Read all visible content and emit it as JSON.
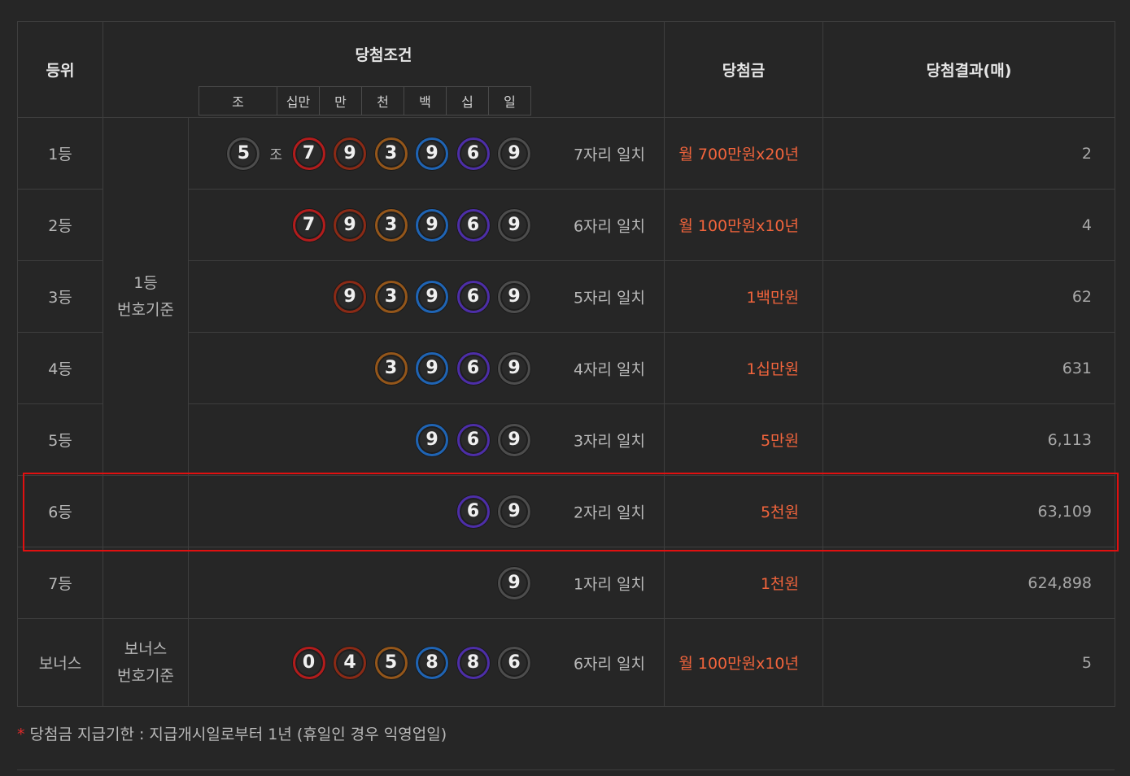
{
  "header": {
    "rank": "등위",
    "condition": "당첨조건",
    "prize": "당첨금",
    "result": "당첨결과(매)",
    "digit_labels": [
      "조",
      "십만",
      "만",
      "천",
      "백",
      "십",
      "일"
    ]
  },
  "basis": {
    "main_line1": "1등",
    "main_line2": "번호기준",
    "bonus_line1": "보너스",
    "bonus_line2": "번호기준"
  },
  "jo_label": "조",
  "rows": [
    {
      "rank": "1등",
      "group": "5",
      "match": "7자리 일치",
      "prize": "월 700만원x20년",
      "count": "2"
    },
    {
      "rank": "2등",
      "match": "6자리 일치",
      "prize": "월 100만원x10년",
      "count": "4"
    },
    {
      "rank": "3등",
      "match": "5자리 일치",
      "prize": "1백만원",
      "count": "62"
    },
    {
      "rank": "4등",
      "match": "4자리 일치",
      "prize": "1십만원",
      "count": "631"
    },
    {
      "rank": "5등",
      "match": "3자리 일치",
      "prize": "5만원",
      "count": "6,113"
    },
    {
      "rank": "6등",
      "match": "2자리 일치",
      "prize": "5천원",
      "count": "63,109"
    },
    {
      "rank": "7등",
      "match": "1자리 일치",
      "prize": "1천원",
      "count": "624,898"
    },
    {
      "rank": "보너스",
      "match": "6자리 일치",
      "prize": "월 100만원x10년",
      "count": "5"
    }
  ],
  "main_digits": [
    "7",
    "9",
    "3",
    "9",
    "6",
    "9"
  ],
  "bonus_digits": [
    "0",
    "4",
    "5",
    "8",
    "8",
    "6"
  ],
  "ball_colors": {
    "c-red": "#b21c1c",
    "c-darkred": "#8a2a16",
    "c-orange": "#94561a",
    "c-blue": "#1f64b4",
    "c-purple": "#4d2ea8",
    "c-gray": "#4d4d4d"
  },
  "highlight_color": "#e01010",
  "prize_color": "#f1643c",
  "note": {
    "star": "*",
    "text": " 당첨금 지급기한 : 지급개시일로부터 1년 (휴일인 경우 익영업일)"
  }
}
